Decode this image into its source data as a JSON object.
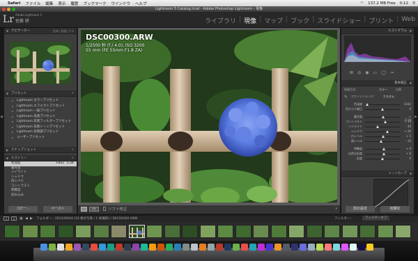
{
  "menubar": {
    "app": "Safari",
    "items": [
      "ファイル",
      "編集",
      "表示",
      "履歴",
      "ブックマーク",
      "ウインドウ",
      "ヘルプ"
    ],
    "status": "137.2 MB Free",
    "clock": "0:12"
  },
  "window_title": "Lightroom 5 Catalog.lrcat - Adobe Photoshop Lightroom - 現像",
  "identity": {
    "logo": "Lr",
    "product": "Adobe Lightroom 5",
    "user": "佐藤 耕"
  },
  "modules": [
    "ライブラリ",
    "現像",
    "マップ",
    "ブック",
    "スライドショー",
    "プリント",
    "Web"
  ],
  "active_module": "現像",
  "left_panel": {
    "navigator": {
      "title": "ナビゲーター",
      "zoom": "全体 | 画面 | 1:1"
    },
    "presets": {
      "title": "プリセット",
      "items": [
        "Lightroom カラープリセット",
        "Lightroom エフェクトプリセット",
        "Lightroom 一般プリセット",
        "Lightroom 白黒プリセット",
        "Lightroom 白黒フィルタープリセット",
        "Lightroom 白黒トーンプリセット",
        "Lightroom 白黒調プリセット",
        "ユーザープリセット"
      ]
    },
    "snapshots": {
      "title": "スナップショット"
    },
    "history": {
      "title": "ヒストリー",
      "rows": [
        {
          "name": "色温度",
          "a": "+842",
          "b": "5.2K"
        },
        {
          "name": "露光量",
          "a": "",
          "b": ""
        },
        {
          "name": "ハイライト",
          "a": "",
          "b": ""
        },
        {
          "name": "シャドウ",
          "a": "",
          "b": ""
        },
        {
          "name": "白レベル",
          "a": "",
          "b": ""
        },
        {
          "name": "コントラスト",
          "a": "",
          "b": ""
        },
        {
          "name": "明瞭度",
          "a": "",
          "b": ""
        },
        {
          "name": "読み込み",
          "a": "",
          "b": ""
        }
      ]
    },
    "copy_button": "コピー...",
    "paste_button": "ペースト"
  },
  "image_info": {
    "filename": "DSC00300.ARW",
    "line1": "1/2500 秒 (f / 4.0), ISO 3200",
    "line2": "55 mm (FE 55mm F1.8 ZA)"
  },
  "toolbar": {
    "softproof": "ソフト校正"
  },
  "right_panel": {
    "histogram_title": "ヒストグラム",
    "basic_title": "基本補正",
    "treatment": {
      "label": "処理方法：",
      "color": "カラー",
      "bw": "白黒"
    },
    "wb_label": "ホワイトバランス：",
    "wb_value": "カスタム",
    "sliders": [
      {
        "name": "色温度",
        "value": 5342,
        "min": 2000,
        "max": 50000,
        "display": "5342"
      },
      {
        "name": "色かぶり補正",
        "value": 0,
        "min": -150,
        "max": 150,
        "display": "0"
      },
      {
        "name": "露光量",
        "value": 0.1,
        "min": -5,
        "max": 5,
        "display": "+ 0.10"
      },
      {
        "name": "コントラスト",
        "value": 14,
        "min": -100,
        "max": 100,
        "display": "+ 14"
      },
      {
        "name": "ハイライト",
        "value": -30,
        "min": -100,
        "max": 100,
        "display": "- 30"
      },
      {
        "name": "シャドウ",
        "value": 26,
        "min": -100,
        "max": 100,
        "display": "+ 26"
      },
      {
        "name": "白レベル",
        "value": 5,
        "min": -100,
        "max": 100,
        "display": "+ 5"
      },
      {
        "name": "黒レベル",
        "value": -10,
        "min": -100,
        "max": 100,
        "display": "- 10"
      },
      {
        "name": "明瞭度",
        "value": 9,
        "min": -100,
        "max": 100,
        "display": "+ 9"
      },
      {
        "name": "自然な彩度",
        "value": 8,
        "min": -100,
        "max": 100,
        "display": "+ 8"
      },
      {
        "name": "彩度",
        "value": 0,
        "min": -100,
        "max": 100,
        "display": "0"
      }
    ],
    "tone_auto": "自動補正",
    "tone_presence": "外観",
    "tone_curve_title": "トーンカーブ",
    "prev_button": "前の設定",
    "reset_button": "初期化"
  },
  "filmstrip_bar": {
    "source": "フォルダー : 2013/09/04  (10 枚の写真 / 1 枚選択) / DSC00300.ARW",
    "filter_label": "フィルター：",
    "filter_value": "フィルターオフ"
  },
  "colors": {
    "panel_bg": "#3d3d3d",
    "panel_header": "#2f2f2f",
    "app_bg": "#1a1a1a",
    "hydrangea": "#5a7be0",
    "leaf": "#3c6b2a"
  }
}
